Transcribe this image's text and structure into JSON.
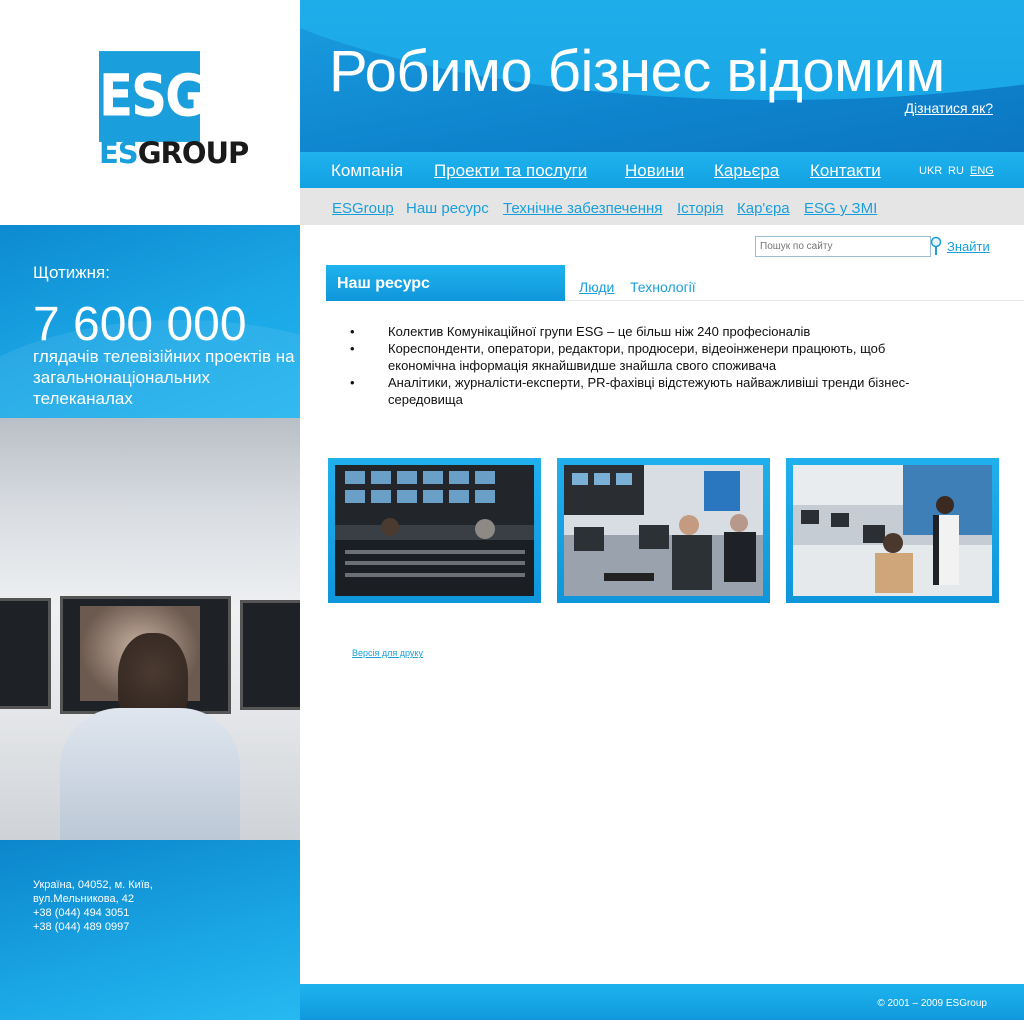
{
  "brand": {
    "logo_mark": "ESG",
    "logo_es": "ES",
    "logo_group": "GROUP"
  },
  "header": {
    "slogan": "Робимо бізнес відомим",
    "learn_more": "Дізнатися як?"
  },
  "main_nav": {
    "items": [
      "Компанія",
      "Проекти та послуги",
      "Новини",
      "Карьєра",
      "Контакти"
    ],
    "languages": [
      "UKR",
      "RU",
      "ENG"
    ]
  },
  "sub_nav": {
    "items": [
      "ESGroup",
      "Наш ресурс",
      "Технічне забезпечення",
      "Історія",
      "Кар'єра",
      "ESG у ЗМІ"
    ]
  },
  "search": {
    "placeholder": "Пошук по сайту",
    "button": "Знайти"
  },
  "tabs": {
    "active": "Наш ресурс",
    "links": [
      "Люди",
      "Технології"
    ]
  },
  "content": {
    "bullets": [
      "Колектив Комунікаційної групи ESG – це більш ніж 240 професіоналів",
      "Кореспонденти, оператори, редактори, продюсери, відеоінженери працюють, щоб економічна інформація якнайшвидше знайшла свого споживача",
      "Аналітики, журналісти-експерти, PR-фахівці відстежують найважливіші  тренди бізнес-середовища"
    ],
    "print_version": "Версія для друку"
  },
  "stats": {
    "label": "Щотижня:",
    "number": "7 600 000",
    "description": "глядачів телевізійних проектів на загальнонаціональних телеканалах"
  },
  "address": {
    "lines": [
      "Україна, 04052, м. Київ,",
      "вул.Мельникова, 42",
      "+38 (044) 494 3051",
      "+38 (044) 489 0997"
    ]
  },
  "footer": {
    "copyright": "©  2001 – 2009 ESGroup"
  },
  "colors": {
    "accent": "#1a9fdc",
    "hero_dark": "#0c76c2",
    "subnav_bg": "#e5e5e5"
  }
}
